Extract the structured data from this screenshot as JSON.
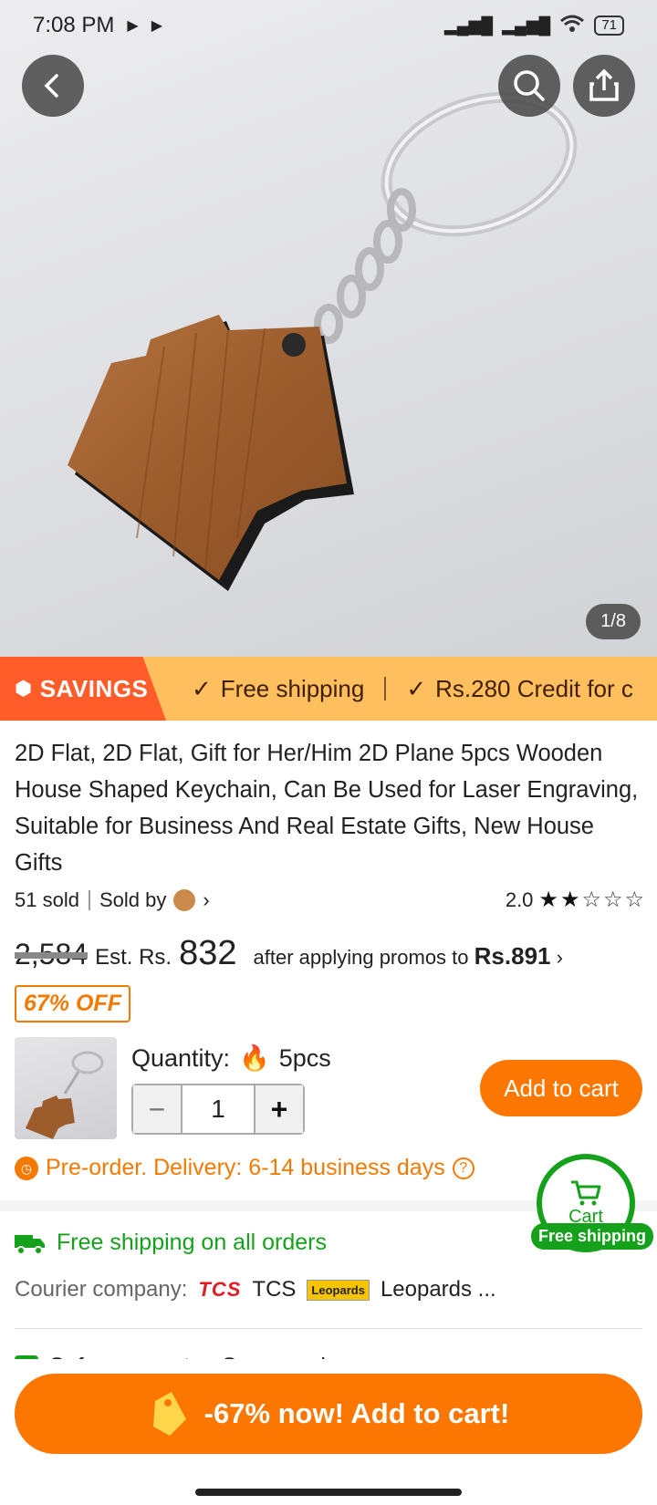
{
  "status_bar": {
    "time": "7:08 PM",
    "battery": "71"
  },
  "gallery": {
    "counter": "1/8"
  },
  "savings": {
    "tag": "SAVINGS",
    "items": [
      "Free shipping",
      "Rs.280 Credit for c"
    ]
  },
  "product": {
    "title": "2D Flat, 2D Flat, Gift for Her/Him 2D Plane 5pcs Wooden House Shaped Keychain, Can Be Used for Laser Engraving, Suitable for Business And Real Estate Gifts, New House Gifts",
    "sold": "51 sold",
    "sold_by": "Sold by",
    "rating": "2.0",
    "rating_stars": 2
  },
  "price": {
    "original": "2,584",
    "est_label": "Est. Rs.",
    "est_value": "832",
    "promo_text": "after applying promos to",
    "promo_price": "Rs.891",
    "discount_badge": "67% OFF"
  },
  "quantity": {
    "label": "Quantity:",
    "pack": "5pcs",
    "value": "1",
    "add_to_cart": "Add to cart"
  },
  "delivery": {
    "preorder": "Pre-order. Delivery: 6-14 business days"
  },
  "cart_float": {
    "label": "Cart",
    "badge": "Free shipping"
  },
  "shipping": {
    "free_text": "Free shipping on all orders",
    "courier_label": "Courier company:",
    "courier_1_logo": "TCS",
    "courier_1": "TCS",
    "courier_2_logo": "Leopards",
    "courier_2": "Leopards ..."
  },
  "safety": {
    "text": "Safe payments · Secure privacy"
  },
  "cta": {
    "label": "-67% now! Add to cart!"
  },
  "colors": {
    "accent": "#fb7701",
    "green": "#16a11c",
    "savings_bg": "#ffbf5e",
    "savings_tag": "#ff5c2a"
  }
}
